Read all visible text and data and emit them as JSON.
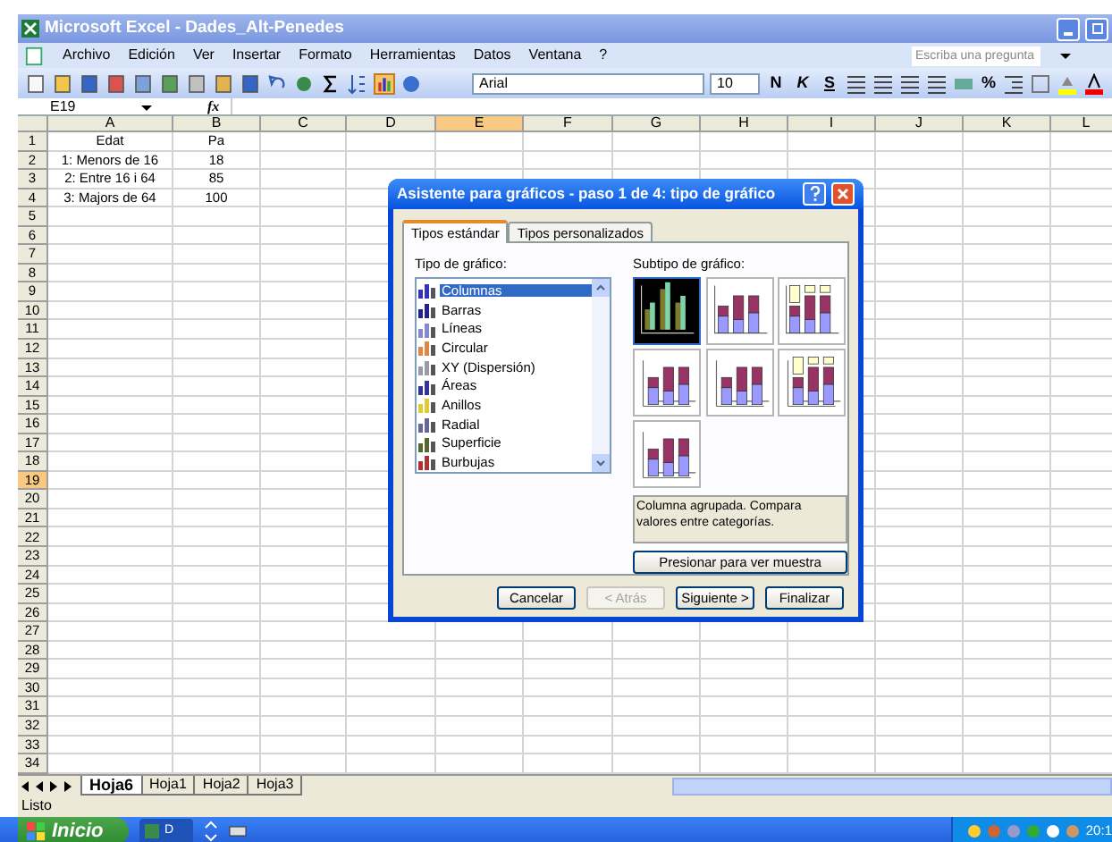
{
  "window": {
    "title": "Microsoft Excel - Dades_Alt-Penedes"
  },
  "menu": [
    "Archivo",
    "Edición",
    "Ver",
    "Insertar",
    "Formato",
    "Herramientas",
    "Datos",
    "Ventana",
    "?"
  ],
  "help_search": {
    "placeholder": "Escriba una pregunta"
  },
  "toolbar": {
    "font": "Arial",
    "size": "10",
    "bold": "N",
    "italic": "K",
    "underline": "S",
    "percent": "%"
  },
  "formula_bar": {
    "name_box": "E19",
    "fx_label": "fx"
  },
  "columns": [
    {
      "label": "A",
      "selected": false
    },
    {
      "label": "B",
      "selected": false
    },
    {
      "label": "C",
      "selected": false
    },
    {
      "label": "D",
      "selected": false
    },
    {
      "label": "E",
      "selected": true
    },
    {
      "label": "F",
      "selected": false
    },
    {
      "label": "G",
      "selected": false
    },
    {
      "label": "H",
      "selected": false
    },
    {
      "label": "I",
      "selected": false
    },
    {
      "label": "J",
      "selected": false
    },
    {
      "label": "K",
      "selected": false
    },
    {
      "label": "L",
      "selected": false
    }
  ],
  "rows": [
    {
      "label": "1",
      "selected": false,
      "cells": [
        "Edat",
        "Pa"
      ]
    },
    {
      "label": "2",
      "selected": false,
      "cells": [
        "1: Menors de 16",
        "18"
      ]
    },
    {
      "label": "3",
      "selected": false,
      "cells": [
        "2: Entre 16 i 64",
        "85"
      ]
    },
    {
      "label": "4",
      "selected": false,
      "cells": [
        "3: Majors de 64",
        "100"
      ]
    },
    {
      "label": "5",
      "selected": false
    },
    {
      "label": "6",
      "selected": false
    },
    {
      "label": "7",
      "selected": false
    },
    {
      "label": "8",
      "selected": false
    },
    {
      "label": "9",
      "selected": false
    },
    {
      "label": "10",
      "selected": false
    },
    {
      "label": "11",
      "selected": false
    },
    {
      "label": "12",
      "selected": false
    },
    {
      "label": "13",
      "selected": false
    },
    {
      "label": "14",
      "selected": false
    },
    {
      "label": "15",
      "selected": false
    },
    {
      "label": "16",
      "selected": false
    },
    {
      "label": "17",
      "selected": false
    },
    {
      "label": "18",
      "selected": false
    },
    {
      "label": "19",
      "selected": true
    },
    {
      "label": "20",
      "selected": false
    },
    {
      "label": "21",
      "selected": false
    },
    {
      "label": "22",
      "selected": false
    },
    {
      "label": "23",
      "selected": false
    },
    {
      "label": "24",
      "selected": false
    },
    {
      "label": "25",
      "selected": false
    },
    {
      "label": "26",
      "selected": false
    },
    {
      "label": "27",
      "selected": false
    },
    {
      "label": "28",
      "selected": false
    },
    {
      "label": "29",
      "selected": false
    },
    {
      "label": "30",
      "selected": false
    },
    {
      "label": "31",
      "selected": false
    },
    {
      "label": "32",
      "selected": false
    },
    {
      "label": "33",
      "selected": false
    },
    {
      "label": "34",
      "selected": false
    }
  ],
  "dialog": {
    "title": "Asistente para gráficos - paso 1 de 4: tipo de gráfico",
    "tabs": [
      {
        "label": "Tipos estándar",
        "selected": true
      },
      {
        "label": "Tipos personalizados",
        "selected": false
      }
    ],
    "type_label": "Tipo de gráfico:",
    "chart_types": [
      {
        "label": "Columnas",
        "selected": true
      },
      {
        "label": "Barras",
        "selected": false
      },
      {
        "label": "Líneas",
        "selected": false
      },
      {
        "label": "Circular",
        "selected": false
      },
      {
        "label": "XY (Dispersión)",
        "selected": false
      },
      {
        "label": "Áreas",
        "selected": false
      },
      {
        "label": "Anillos",
        "selected": false
      },
      {
        "label": "Radial",
        "selected": false
      },
      {
        "label": "Superficie",
        "selected": false
      },
      {
        "label": "Burbujas",
        "selected": false
      }
    ],
    "subtype_label": "Subtipo de gráfico:",
    "subtypes": [
      {
        "selected": true
      },
      {
        "selected": false
      },
      {
        "selected": false
      },
      {
        "selected": false
      },
      {
        "selected": false
      },
      {
        "selected": false
      },
      {
        "selected": false
      }
    ],
    "description": "Columna agrupada. Compara valores entre categorías.",
    "preview_button": "Presionar para ver muestra",
    "buttons": [
      {
        "label": "Cancelar",
        "disabled": false
      },
      {
        "label": "< Atrás",
        "disabled": true
      },
      {
        "label": "Siguiente >",
        "disabled": false
      },
      {
        "label": "Finalizar",
        "disabled": false
      }
    ]
  },
  "sheet_tabs": [
    {
      "label": "Hoja6",
      "selected": true
    },
    {
      "label": "Hoja1",
      "selected": false
    },
    {
      "label": "Hoja2",
      "selected": false
    },
    {
      "label": "Hoja3",
      "selected": false
    }
  ],
  "status_bar": {
    "text": "Listo"
  },
  "taskbar": {
    "start": "Inicio",
    "tasks": [
      "D"
    ],
    "clock": "20:1"
  }
}
